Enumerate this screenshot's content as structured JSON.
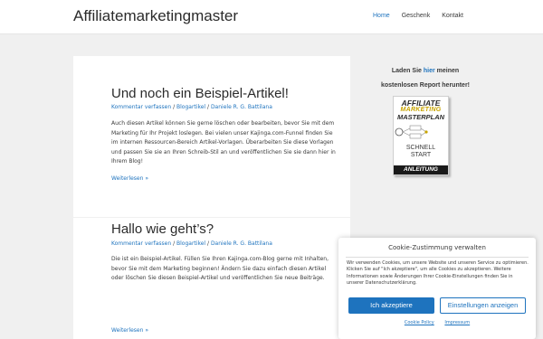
{
  "header": {
    "site_title": "Affiliatemarketingmaster",
    "nav": [
      {
        "label": "Home",
        "active": true
      },
      {
        "label": "Geschenk",
        "active": false
      },
      {
        "label": "Kontakt",
        "active": false
      }
    ]
  },
  "posts": [
    {
      "title": "Und noch ein Beispiel-Artikel!",
      "meta": {
        "comment": "Kommentar verfassen",
        "category": "Blogartikel",
        "author": "Daniele R. G. Battilana"
      },
      "excerpt": "Auch diesen Artikel können Sie gerne löschen oder bearbeiten, bevor Sie mit dem Marketing für Ihr Projekt loslegen. Bei vielen unser Kajinga.com-Funnel finden Sie im internen Ressourcen-Bereich Artikel-Vorlagen. Überarbeiten Sie diese Vorlagen und passen Sie sie an Ihren Schreib-Stil an und veröffentlichen Sie sie dann hier in Ihrem Blog!",
      "read_more": "Weiterlesen »"
    },
    {
      "title": "Hallo wie geht’s?",
      "meta": {
        "comment": "Kommentar verfassen",
        "category": "Blogartikel",
        "author": "Daniele R. G. Battilana"
      },
      "excerpt": "Die ist ein Beispiel-Artikel. Füllen Sie Ihren Kajinga.com-Blog gerne mit Inhalten, bevor Sie mit dem Marketing beginnen! Ändern Sie dazu einfach diesen Artikel oder löschen Sie diesen Beispiel-Artikel und veröffentlichen Sie neue Beiträge.",
      "read_more": "Weiterlesen »"
    }
  ],
  "meta_separator": "/",
  "sidebar": {
    "text_before": "Laden Sie ",
    "link": "hier",
    "text_after": " meinen",
    "line2": "kostenlosen Report herunter!",
    "book": {
      "line1": "AFFILIATE",
      "line2": "MARKETING",
      "line3": "MASTERPLAN",
      "line4": "SCHNELL",
      "line5": "START",
      "line6": "ANLEITUNG"
    }
  },
  "cookie": {
    "title": "Cookie-Zustimmung verwalten",
    "body": "Wir verwenden Cookies, um unsere Website und unseren Service zu optimieren. Klicken Sie auf \"Ich akzeptiere\", um alle Cookies zu akzeptieren. Weitere Informationen sowie Änderungen Ihrer Cookie-Einstellungen finden Sie in unserer Datenschutzerklärung.",
    "accept": "Ich akzeptiere",
    "settings": "Einstellungen anzeigen",
    "policy_link": "Cookie Policy",
    "imprint_link": "Impressum"
  },
  "colors": {
    "accent": "#1e73be",
    "background": "#f0f0f0",
    "card": "#ffffff",
    "gold": "#c8a400"
  }
}
